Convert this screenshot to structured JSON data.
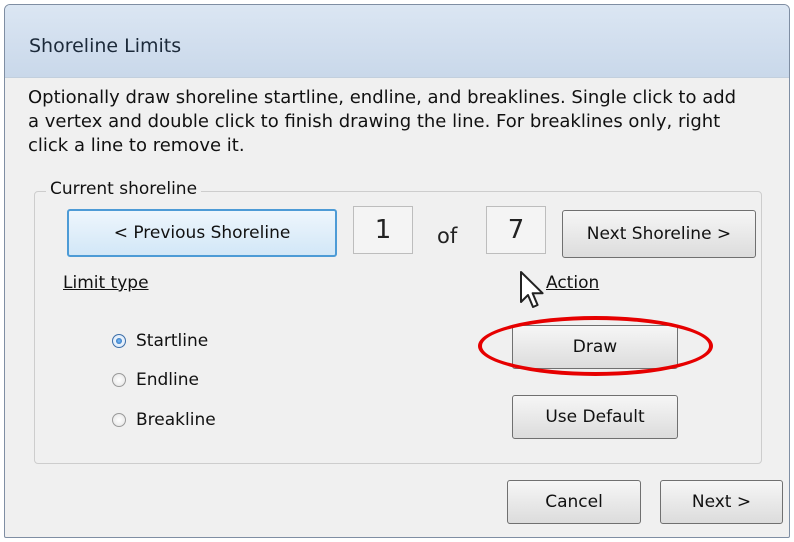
{
  "window": {
    "title": "Shoreline Limits"
  },
  "description": "Optionally draw shoreline startline, endline, and breaklines. Single click to add a vertex and double click to finish drawing the line. For breaklines only, right click a line to remove it.",
  "current_shoreline": {
    "group_label": "Current shoreline",
    "previous_label": "< Previous Shoreline",
    "current_index": "1",
    "of_label": "of",
    "total": "7",
    "next_label": "Next Shoreline >"
  },
  "limit_type": {
    "label": "Limit type",
    "options": [
      {
        "label": "Startline",
        "selected": true
      },
      {
        "label": "Endline",
        "selected": false
      },
      {
        "label": "Breakline",
        "selected": false
      }
    ]
  },
  "action": {
    "label": "Action",
    "draw_label": "Draw",
    "use_default_label": "Use Default"
  },
  "footer": {
    "cancel_label": "Cancel",
    "next_label": "Next >"
  },
  "colors": {
    "highlight": "#e60000",
    "focus_border": "#4d9bd6"
  },
  "icons": {
    "cursor": "arrow-cursor-icon"
  }
}
